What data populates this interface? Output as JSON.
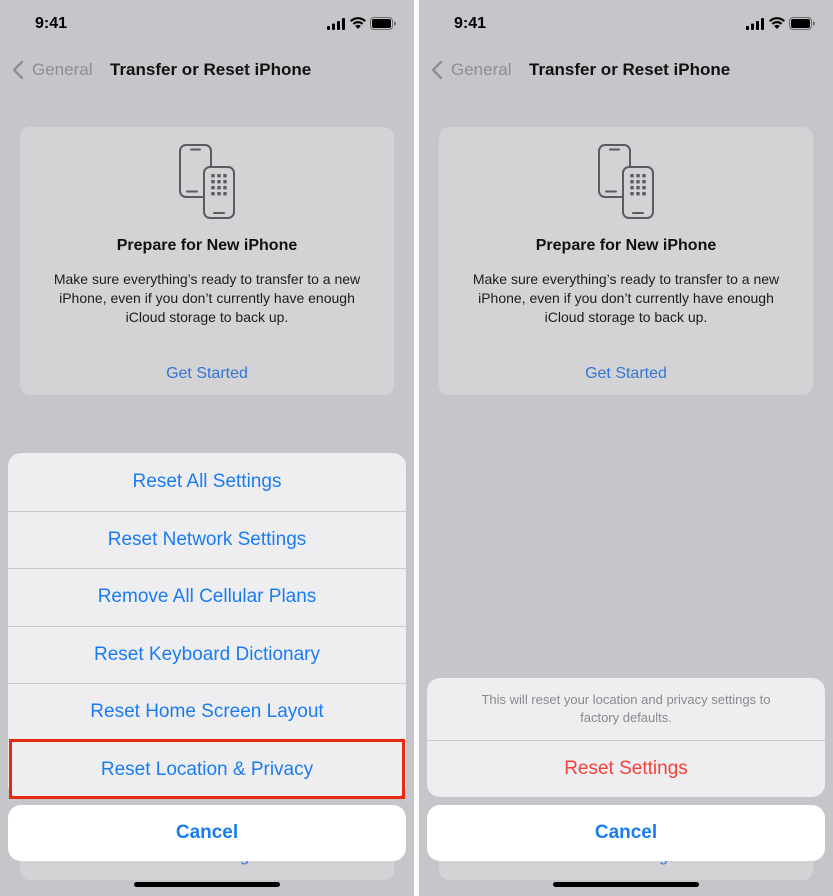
{
  "status_bar": {
    "time": "9:41",
    "icons": [
      "cellular-signal-icon",
      "wifi-icon",
      "battery-icon"
    ]
  },
  "nav": {
    "back_icon": "chevron-left-icon",
    "back_label": "General",
    "title": "Transfer or Reset iPhone"
  },
  "card": {
    "icon": "two-phones-icon",
    "title": "Prepare for New iPhone",
    "description_lines": [
      "Make sure everything’s ready to transfer to a new",
      "iPhone, even if you don’t currently have enough",
      "iCloud storage to back up."
    ],
    "action_label": "Get Started"
  },
  "background_list": {
    "erase_label": "Erase All Content and Settings"
  },
  "left_sheet": {
    "items": [
      {
        "label": "Reset All Settings"
      },
      {
        "label": "Reset Network Settings"
      },
      {
        "label": "Remove All Cellular Plans"
      },
      {
        "label": "Reset Keyboard Dictionary"
      },
      {
        "label": "Reset Home Screen Layout"
      },
      {
        "label": "Reset Location & Privacy"
      }
    ],
    "highlighted_index": 5,
    "cancel_label": "Cancel"
  },
  "right_sheet": {
    "message_lines": [
      "This will reset your location and privacy settings to",
      "factory defaults."
    ],
    "confirm_label": "Reset Settings",
    "cancel_label": "Cancel"
  },
  "colors": {
    "dim_background": "#c6c6ca",
    "card": "#d3d3d6",
    "sheet": "#eeeef0",
    "accent": "#1a7cf3",
    "dim_accent": "#3374d4",
    "destructive": "#f2413a",
    "secondary_text": "#8a8a8e",
    "annotation": "#e32b12",
    "separator": "#c9c9cd",
    "text": "#111111",
    "nav_gray": "#8d8d92",
    "cancel_bg": "#ffffff"
  }
}
